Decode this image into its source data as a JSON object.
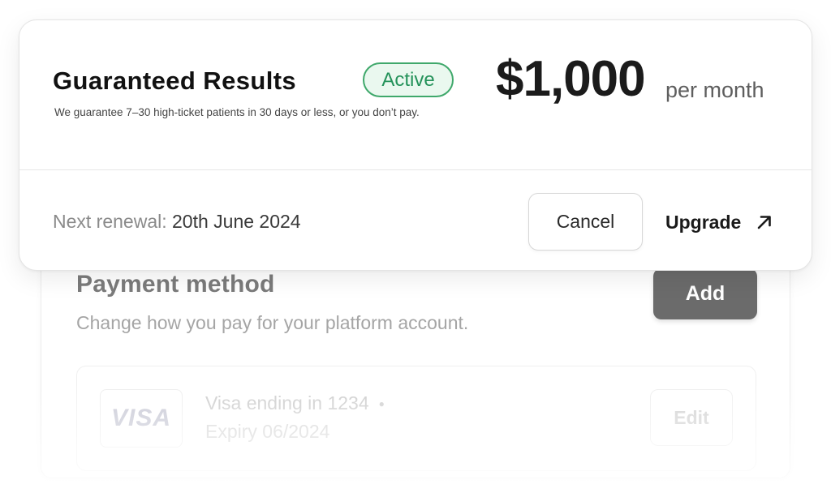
{
  "subscription": {
    "title": "Guaranteed Results",
    "status": "Active",
    "description": "We guarantee 7–30 high-ticket patients in 30 days or less, or you don’t pay.",
    "price": "$1,000",
    "period": "per month",
    "renewal_label": "Next renewal:",
    "renewal_date": "20th June 2024",
    "cancel_label": "Cancel",
    "upgrade_label": "Upgrade",
    "upgrade_icon": "arrow-up-right-icon"
  },
  "payment": {
    "title": "Payment method",
    "subtitle": "Change how you pay for your platform account.",
    "add_label": "Add",
    "card": {
      "brand": "VISA",
      "ending": "Visa ending in 1234",
      "expiry": "Expiry 06/2024",
      "edit_label": "Edit"
    }
  },
  "colors": {
    "status_green": "#24925a",
    "status_green_bg": "#eaf8ef",
    "add_button_bg": "#6b6b6b"
  }
}
